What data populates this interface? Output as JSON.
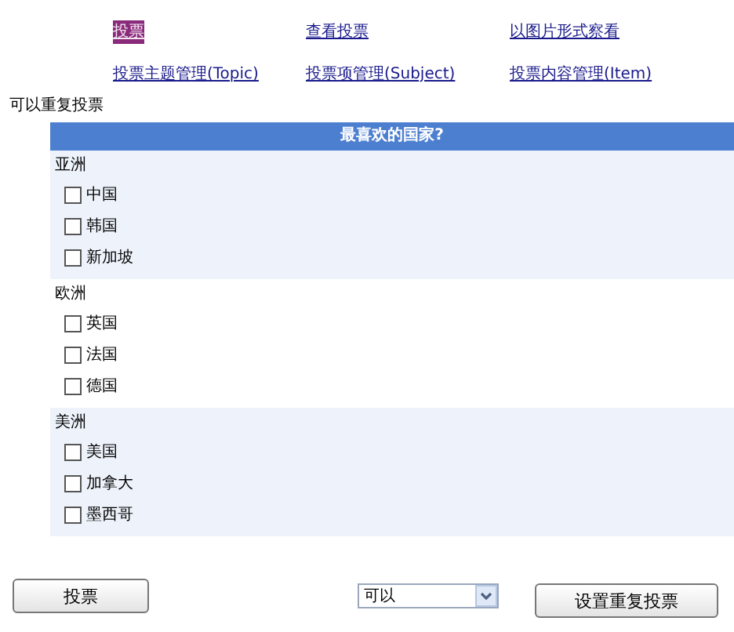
{
  "nav_links": [
    {
      "label": "投票",
      "selected": true
    },
    {
      "label": "查看投票",
      "selected": false
    },
    {
      "label": "以图片形式察看",
      "selected": false
    },
    {
      "label": "投票主题管理(Topic)",
      "selected": false
    },
    {
      "label": "投票项管理(Subject)",
      "selected": false
    },
    {
      "label": "投票内容管理(Item)",
      "selected": false
    }
  ],
  "notice": "可以重复投票",
  "poll": {
    "title": "最喜欢的国家?",
    "groups": [
      {
        "name": "亚洲",
        "options": [
          {
            "label": "中国",
            "checked": false
          },
          {
            "label": "韩国",
            "checked": false
          },
          {
            "label": "新加坡",
            "checked": false
          }
        ]
      },
      {
        "name": "欧洲",
        "options": [
          {
            "label": "英国",
            "checked": false
          },
          {
            "label": "法国",
            "checked": false
          },
          {
            "label": "德国",
            "checked": false
          }
        ]
      },
      {
        "name": "美洲",
        "options": [
          {
            "label": "美国",
            "checked": false
          },
          {
            "label": "加拿大",
            "checked": false
          },
          {
            "label": "墨西哥",
            "checked": false
          }
        ]
      }
    ]
  },
  "vote_button": "投票",
  "repeat_select": {
    "value": "可以"
  },
  "setting_button": "设置重复投票"
}
